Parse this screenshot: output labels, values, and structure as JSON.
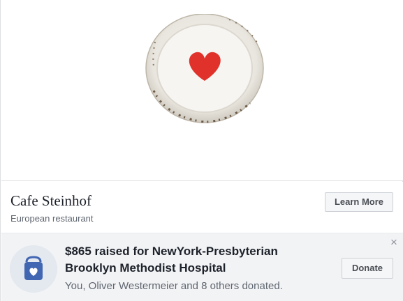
{
  "ad": {
    "page_name": "Cafe Steinhof",
    "category": "European restaurant",
    "cta_label": "Learn More",
    "image_icon": "heart-plate-image"
  },
  "fundraiser": {
    "title_line1": "$865 raised for NewYork-Presbyterian",
    "title_line2": "Brooklyn Methodist Hospital",
    "subtitle": "You, Oliver Westermeier and 8 others donated.",
    "donate_label": "Donate",
    "close_glyph": "×",
    "badge_icon": "donation-bag-icon"
  },
  "colors": {
    "accent_blue": "#4267b2",
    "heart_red": "#e0322b",
    "panel_bg": "#f2f3f5"
  }
}
